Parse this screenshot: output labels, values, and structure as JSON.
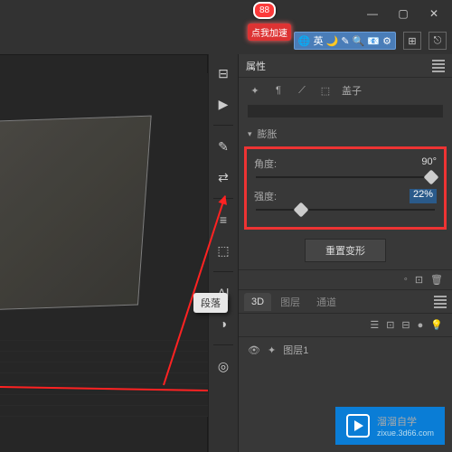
{
  "balloon": {
    "badge": "88",
    "tag": "点我加速"
  },
  "ime": {
    "lang": "英",
    "icons": "🌙 ✎ 🔍 📧 ⚙"
  },
  "window": {
    "min": "—",
    "max": "▢",
    "close": "✕",
    "grid": "⊞",
    "share": "⎋"
  },
  "tools": [
    "⊟",
    "▶",
    "",
    "✎",
    "⇄",
    "",
    "≡",
    "⬚",
    "",
    "A|",
    "◑",
    "",
    "◎"
  ],
  "properties": {
    "title": "属性",
    "typetools": [
      "✦",
      "¶",
      "⟋",
      "⬚"
    ],
    "typelabel": "盖子",
    "section": "膨胀",
    "angle": {
      "label": "角度:",
      "value": "90°",
      "pos": 95
    },
    "intensity": {
      "label": "强度:",
      "value": "22%",
      "pos": 22
    },
    "reset": "重置变形"
  },
  "tabs": {
    "t3d": "3D",
    "layers": "图层",
    "channels": "通道"
  },
  "layertools": [
    "☰",
    "⊡",
    "⊟",
    "●",
    "💡"
  ],
  "layer": {
    "name": "图层1",
    "eye": "👁"
  },
  "segtag": "段落",
  "watermark": {
    "brand": "溜溜自学",
    "url": "zixue.3d66.com"
  }
}
